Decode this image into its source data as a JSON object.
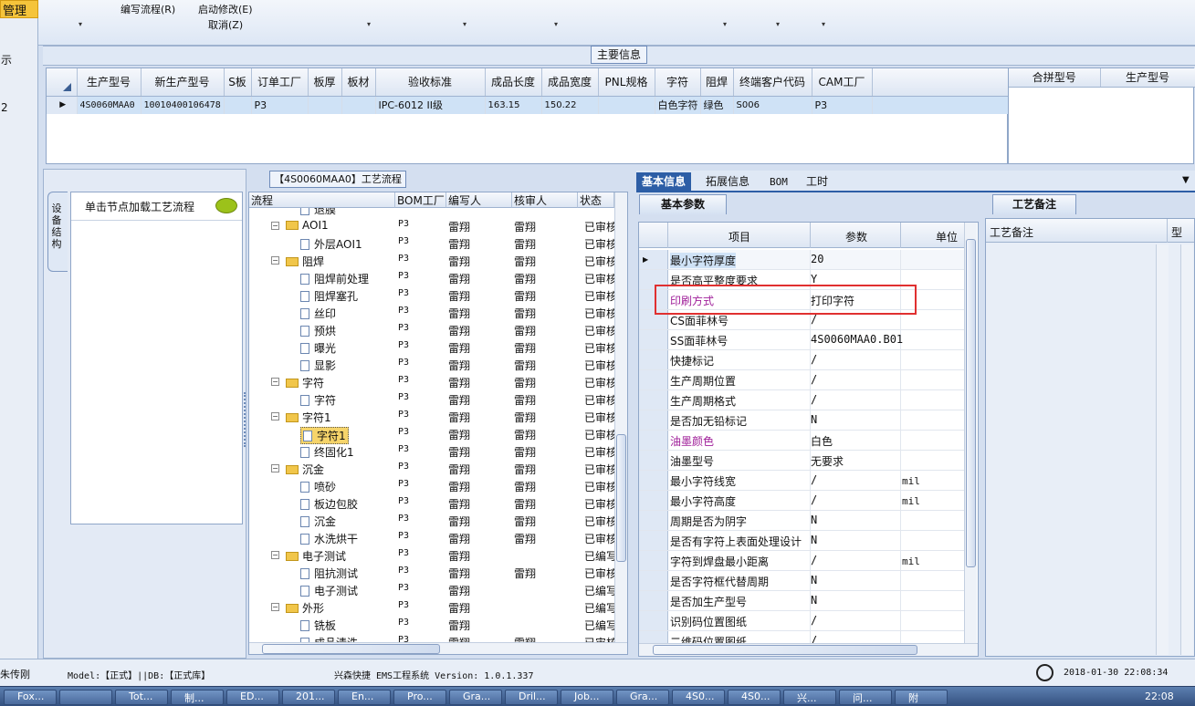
{
  "ribbon": {
    "top_label": "管理",
    "menu_edit_flow": "编写流程(R)",
    "menu_start_modify": "启动修改(E)",
    "menu_cancel": "取消(Z)",
    "left_labels": [
      "示",
      "2"
    ]
  },
  "main_info": {
    "title": "主要信息",
    "columns": [
      "生产型号",
      "新生产型号",
      "S板",
      "订单工厂",
      "板厚",
      "板材",
      "验收标准",
      "成品长度",
      "成品宽度",
      "PNL规格",
      "字符",
      "阻焊",
      "终端客户代码",
      "CAM工厂"
    ],
    "row": [
      "4S0060MAA0",
      "10010400106478",
      "",
      "P3",
      "",
      "",
      "IPC-6012 II级",
      "163.15",
      "150.22",
      "",
      "白色字符",
      "绿色",
      "S006",
      "P3"
    ],
    "right_columns": [
      "合拼型号",
      "生产型号"
    ]
  },
  "flow_panel": {
    "vertical_tab": "设备结构",
    "hint": "单击节点加载工艺流程",
    "tree_title": "【4S0060MAA0】工艺流程",
    "columns": [
      "流程",
      "BOM工厂",
      "编写人",
      "核审人",
      "状态"
    ],
    "rows": [
      {
        "level": 2,
        "type": "doc",
        "name": "退膜",
        "bom": "",
        "writer": "",
        "reviewer": "",
        "status": ""
      },
      {
        "level": 1,
        "type": "folder",
        "name": "AOI1",
        "bom": "P3",
        "writer": "雷翔",
        "reviewer": "雷翔",
        "status": "已审核"
      },
      {
        "level": 2,
        "type": "doc",
        "name": "外层AOI1",
        "bom": "P3",
        "writer": "雷翔",
        "reviewer": "雷翔",
        "status": "已审核"
      },
      {
        "level": 1,
        "type": "folder",
        "name": "阻焊",
        "bom": "P3",
        "writer": "雷翔",
        "reviewer": "雷翔",
        "status": "已审核"
      },
      {
        "level": 2,
        "type": "doc",
        "name": "阻焊前处理",
        "bom": "P3",
        "writer": "雷翔",
        "reviewer": "雷翔",
        "status": "已审核"
      },
      {
        "level": 2,
        "type": "doc",
        "name": "阻焊塞孔",
        "bom": "P3",
        "writer": "雷翔",
        "reviewer": "雷翔",
        "status": "已审核"
      },
      {
        "level": 2,
        "type": "doc",
        "name": "丝印",
        "bom": "P3",
        "writer": "雷翔",
        "reviewer": "雷翔",
        "status": "已审核"
      },
      {
        "level": 2,
        "type": "doc",
        "name": "预烘",
        "bom": "P3",
        "writer": "雷翔",
        "reviewer": "雷翔",
        "status": "已审核"
      },
      {
        "level": 2,
        "type": "doc",
        "name": "曝光",
        "bom": "P3",
        "writer": "雷翔",
        "reviewer": "雷翔",
        "status": "已审核"
      },
      {
        "level": 2,
        "type": "doc",
        "name": "显影",
        "bom": "P3",
        "writer": "雷翔",
        "reviewer": "雷翔",
        "status": "已审核"
      },
      {
        "level": 1,
        "type": "folder",
        "name": "字符",
        "bom": "P3",
        "writer": "雷翔",
        "reviewer": "雷翔",
        "status": "已审核"
      },
      {
        "level": 2,
        "type": "doc",
        "name": "字符",
        "bom": "P3",
        "writer": "雷翔",
        "reviewer": "雷翔",
        "status": "已审核"
      },
      {
        "level": 1,
        "type": "folder",
        "name": "字符1",
        "bom": "P3",
        "writer": "雷翔",
        "reviewer": "雷翔",
        "status": "已审核"
      },
      {
        "level": 2,
        "type": "doc",
        "name": "字符1",
        "bom": "P3",
        "writer": "雷翔",
        "reviewer": "雷翔",
        "status": "已审核",
        "selected": true
      },
      {
        "level": 2,
        "type": "doc",
        "name": "终固化1",
        "bom": "P3",
        "writer": "雷翔",
        "reviewer": "雷翔",
        "status": "已审核"
      },
      {
        "level": 1,
        "type": "folder",
        "name": "沉金",
        "bom": "P3",
        "writer": "雷翔",
        "reviewer": "雷翔",
        "status": "已审核"
      },
      {
        "level": 2,
        "type": "doc",
        "name": "喷砂",
        "bom": "P3",
        "writer": "雷翔",
        "reviewer": "雷翔",
        "status": "已审核"
      },
      {
        "level": 2,
        "type": "doc",
        "name": "板边包胶",
        "bom": "P3",
        "writer": "雷翔",
        "reviewer": "雷翔",
        "status": "已审核"
      },
      {
        "level": 2,
        "type": "doc",
        "name": "沉金",
        "bom": "P3",
        "writer": "雷翔",
        "reviewer": "雷翔",
        "status": "已审核"
      },
      {
        "level": 2,
        "type": "doc",
        "name": "水洗烘干",
        "bom": "P3",
        "writer": "雷翔",
        "reviewer": "雷翔",
        "status": "已审核"
      },
      {
        "level": 1,
        "type": "folder",
        "name": "电子测试",
        "bom": "P3",
        "writer": "雷翔",
        "reviewer": "",
        "status": "已编写"
      },
      {
        "level": 2,
        "type": "doc",
        "name": "阻抗测试",
        "bom": "P3",
        "writer": "雷翔",
        "reviewer": "雷翔",
        "status": "已审核"
      },
      {
        "level": 2,
        "type": "doc",
        "name": "电子测试",
        "bom": "P3",
        "writer": "雷翔",
        "reviewer": "",
        "status": "已编写"
      },
      {
        "level": 1,
        "type": "folder",
        "name": "外形",
        "bom": "P3",
        "writer": "雷翔",
        "reviewer": "",
        "status": "已编写"
      },
      {
        "level": 2,
        "type": "doc",
        "name": "铣板",
        "bom": "P3",
        "writer": "雷翔",
        "reviewer": "",
        "status": "已编写"
      },
      {
        "level": 2,
        "type": "doc",
        "name": "成品清洗",
        "bom": "P3",
        "writer": "雷翔",
        "reviewer": "雷翔",
        "status": "已审核"
      }
    ]
  },
  "info_tabs": {
    "tabs": [
      "基本信息",
      "拓展信息",
      "BOM",
      "工时"
    ],
    "active": "基本信息"
  },
  "params": {
    "tab": "基本参数",
    "columns": [
      "项目",
      "参数",
      "单位"
    ],
    "highlight_color": "#e03030",
    "rows": [
      {
        "k": "最小字符厚度",
        "v": "20",
        "u": "",
        "current": true
      },
      {
        "k": "是否高平整度要求",
        "v": "Y",
        "u": ""
      },
      {
        "k": "印刷方式",
        "v": "打印字符",
        "u": "",
        "magenta": true,
        "boxed": true
      },
      {
        "k": "CS面菲林号",
        "v": "/",
        "u": ""
      },
      {
        "k": "SS面菲林号",
        "v": "4S0060MAA0.B01",
        "u": ""
      },
      {
        "k": "快捷标记",
        "v": "/",
        "u": ""
      },
      {
        "k": "生产周期位置",
        "v": "/",
        "u": ""
      },
      {
        "k": "生产周期格式",
        "v": "/",
        "u": ""
      },
      {
        "k": "是否加无铅标记",
        "v": "N",
        "u": ""
      },
      {
        "k": "油墨颜色",
        "v": "白色",
        "u": "",
        "magenta": true
      },
      {
        "k": "油墨型号",
        "v": "无要求",
        "u": ""
      },
      {
        "k": "最小字符线宽",
        "v": "/",
        "u": "mil"
      },
      {
        "k": "最小字符高度",
        "v": "/",
        "u": "mil"
      },
      {
        "k": "周期是否为阴字",
        "v": "N",
        "u": ""
      },
      {
        "k": "是否有字符上表面处理设计",
        "v": "N",
        "u": ""
      },
      {
        "k": "字符到焊盘最小距离",
        "v": "/",
        "u": "mil"
      },
      {
        "k": "是否字符框代替周期",
        "v": "N",
        "u": ""
      },
      {
        "k": "是否加生产型号",
        "v": "N",
        "u": ""
      },
      {
        "k": "识别码位置图纸",
        "v": "/",
        "u": ""
      },
      {
        "k": "二维码位置图纸",
        "v": "/",
        "u": ""
      }
    ]
  },
  "notes": {
    "tab": "工艺备注",
    "col1": "工艺备注",
    "col2": "型"
  },
  "status_bar": {
    "user": "朱传刚",
    "model": "Model:【正式】||DB:【正式库】",
    "app": "兴森快捷 EMS工程系统 Version: 1.0.1.337",
    "datetime": "2018-01-30 22:08:34"
  },
  "taskbar": {
    "items": [
      "Fox...",
      "",
      "Tot...",
      "制...",
      "ED...",
      "201...",
      "En...",
      "Pro...",
      "Gra...",
      "Dril...",
      "Job...",
      "Gra...",
      "4S0...",
      "4S0...",
      "兴...",
      "问...",
      "附"
    ],
    "clock": "22:08"
  }
}
